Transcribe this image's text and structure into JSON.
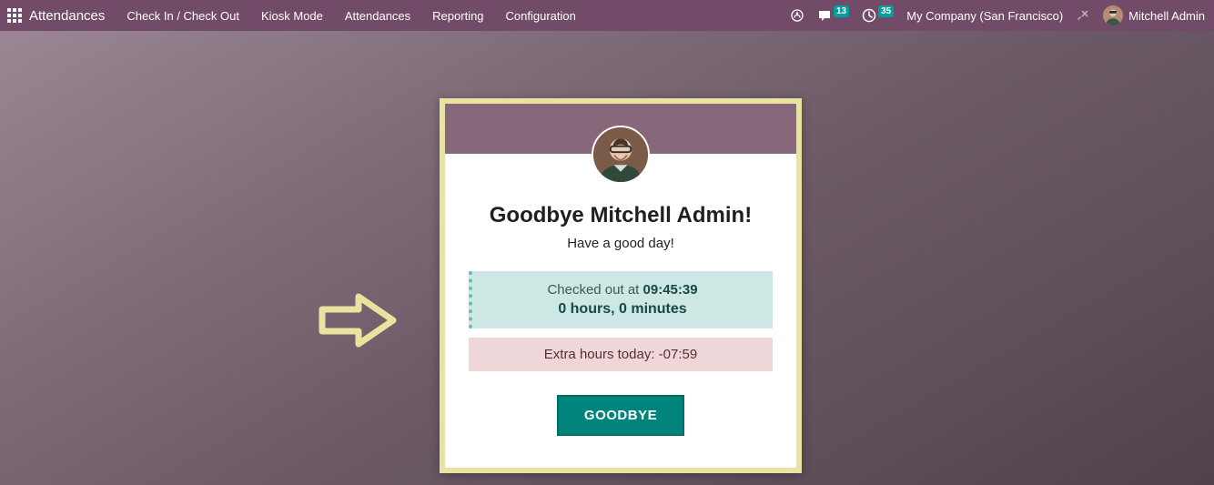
{
  "navbar": {
    "brand": "Attendances",
    "menu": [
      "Check In / Check Out",
      "Kiosk Mode",
      "Attendances",
      "Reporting",
      "Configuration"
    ],
    "messages_badge": "13",
    "activities_badge": "35",
    "company": "My Company (San Francisco)",
    "user": "Mitchell Admin"
  },
  "card": {
    "greeting": "Goodbye Mitchell Admin!",
    "subtext": "Have a good day!",
    "checked_out_prefix": "Checked out at ",
    "checked_out_time": "09:45:39",
    "worked": "0 hours, 0 minutes",
    "extra_prefix": "Extra hours today: ",
    "extra_value": "-07:59",
    "button": "GOODBYE"
  }
}
